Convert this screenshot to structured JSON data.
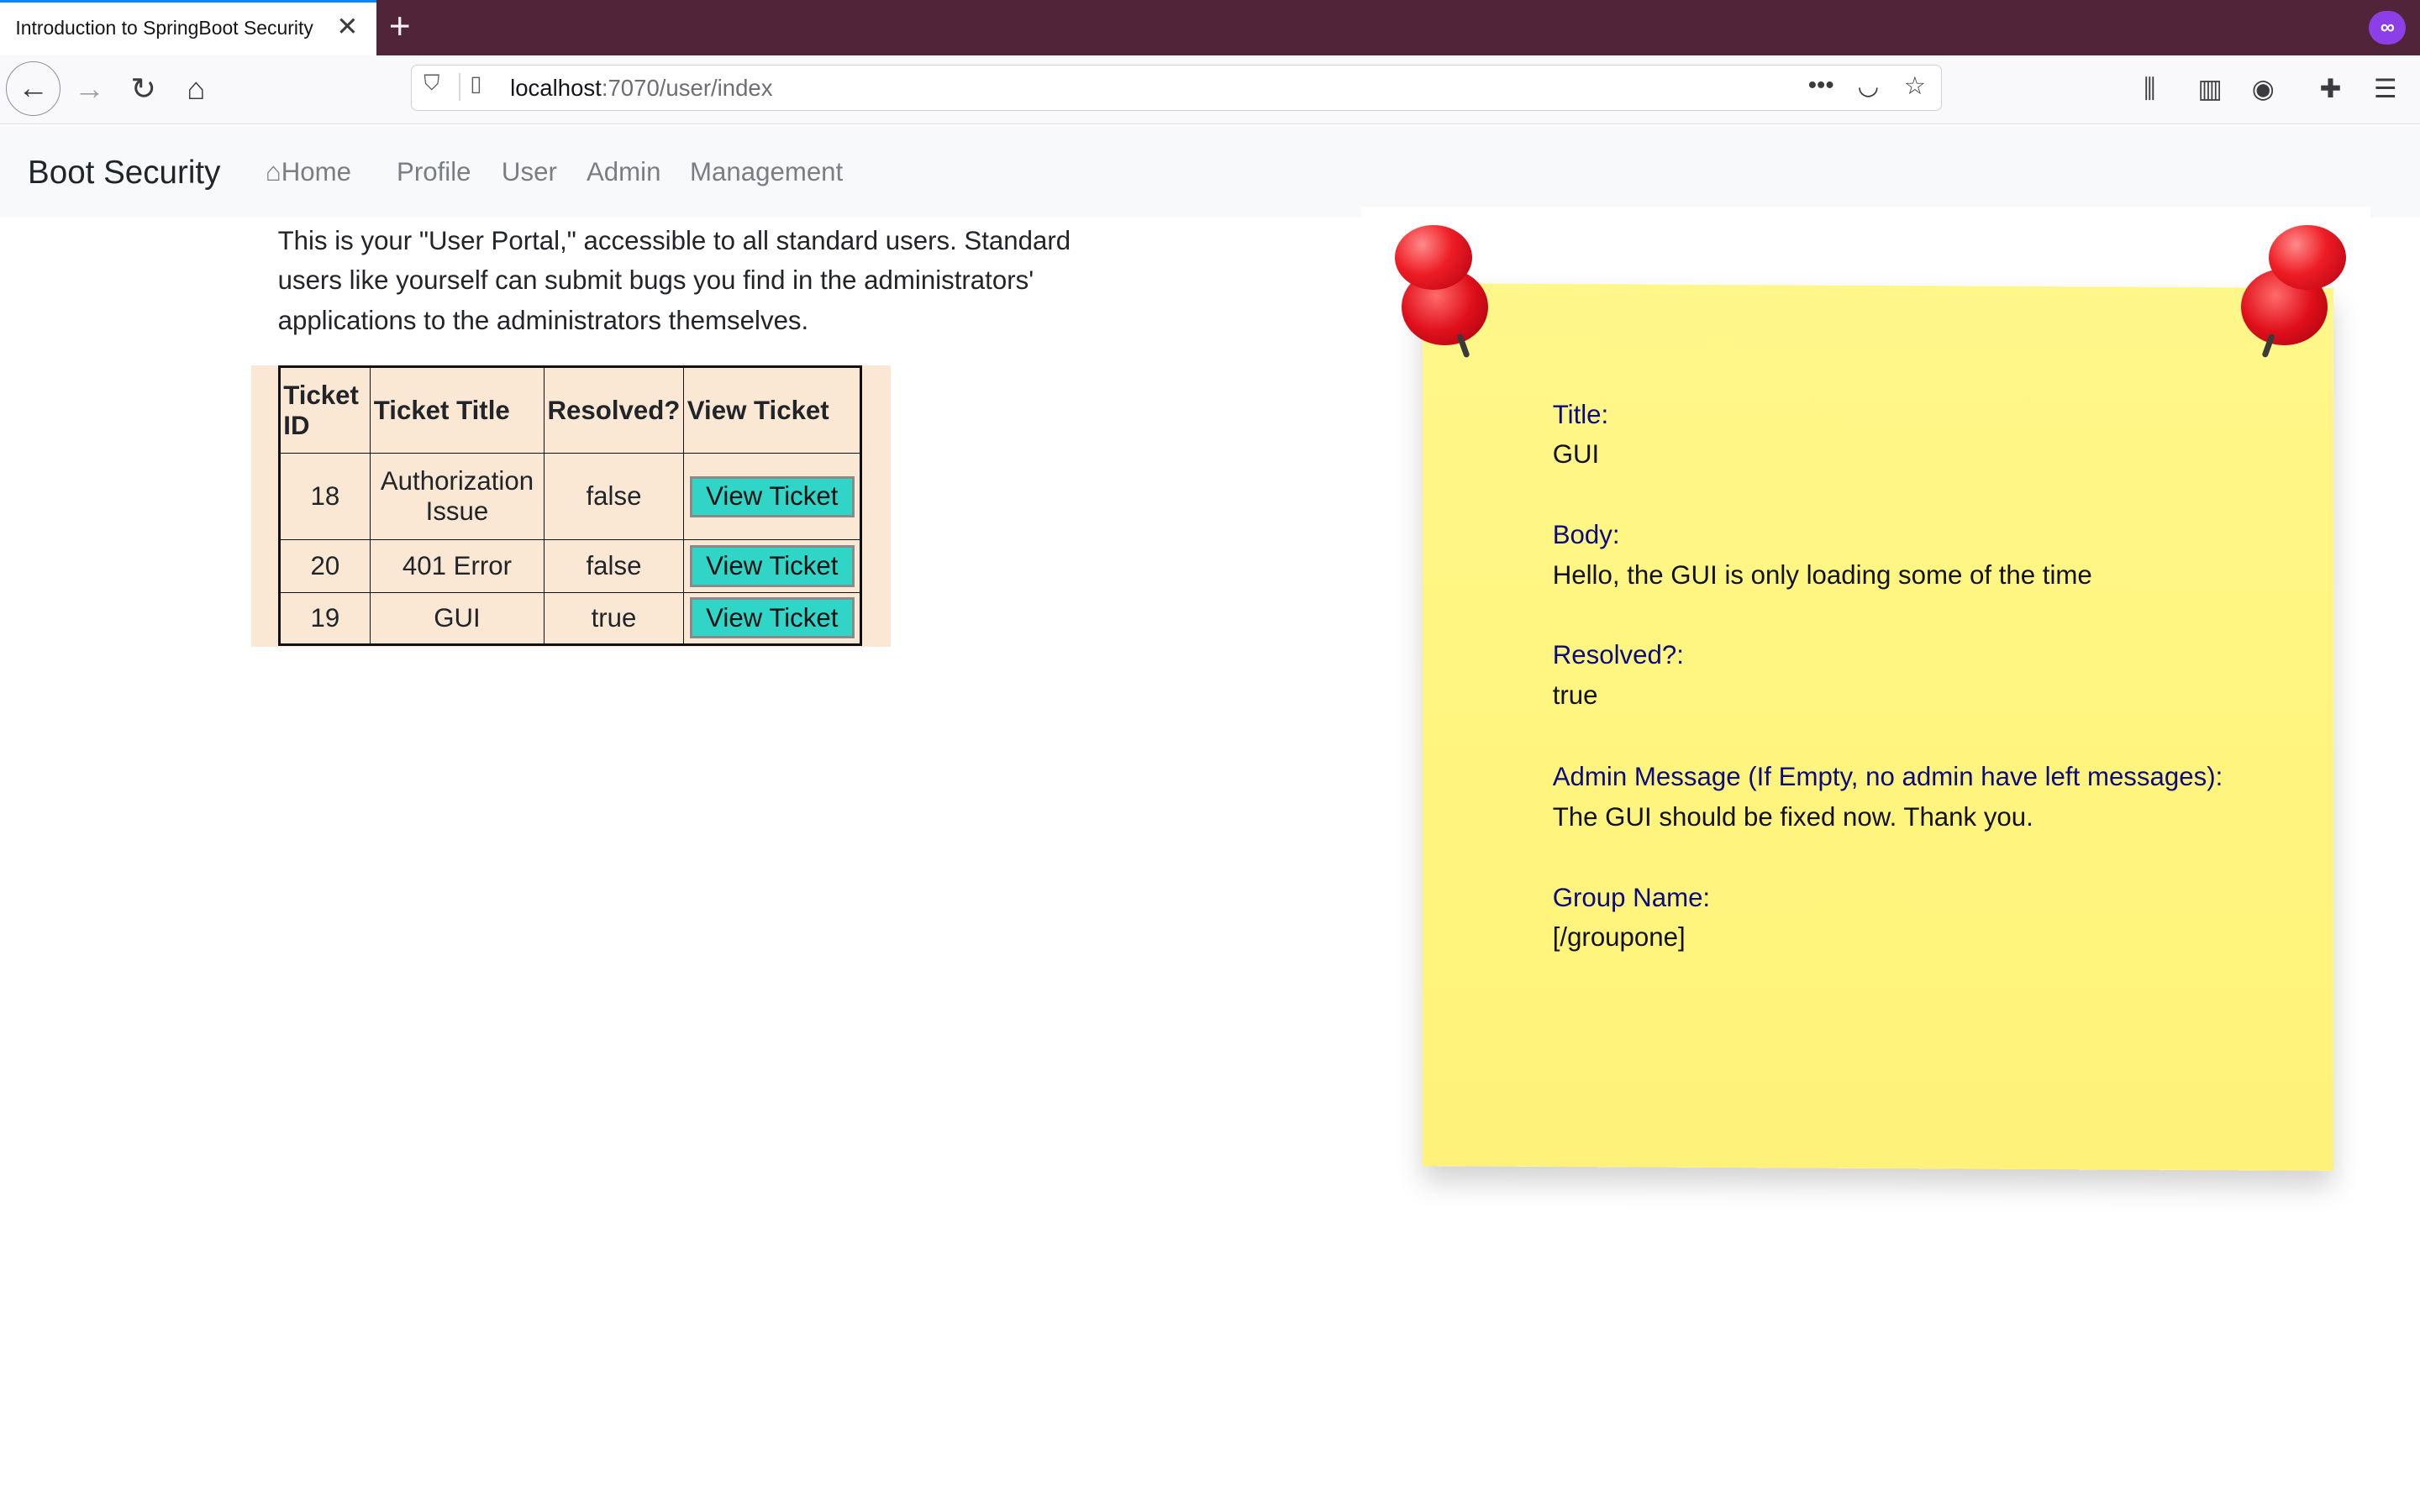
{
  "browser": {
    "tab_title": "Introduction to SpringBoot Security",
    "url_host": "localhost",
    "url_rest": ":7070/user/index"
  },
  "app": {
    "brand": "Boot Security",
    "nav": [
      "Home",
      "Profile",
      "User",
      "Admin",
      "Management"
    ]
  },
  "intro": "This is your \"User Portal,\" accessible to all standard users. Standard users like yourself can submit bugs you find in the administrators' applications to the administrators themselves.",
  "table": {
    "headers": [
      "Ticket ID",
      "Ticket Title",
      "Resolved?",
      "View Ticket"
    ],
    "rows": [
      {
        "id": "18",
        "title": "Authorization Issue",
        "resolved": "false",
        "action": "View Ticket"
      },
      {
        "id": "20",
        "title": "401 Error",
        "resolved": "false",
        "action": "View Ticket"
      },
      {
        "id": "19",
        "title": "GUI",
        "resolved": "true",
        "action": "View Ticket"
      }
    ]
  },
  "note": {
    "title_label": "Title:",
    "title_value": "GUI",
    "body_label": "Body:",
    "body_value": "Hello, the GUI is only loading some of the time",
    "resolved_label": "Resolved?:",
    "resolved_value": "true",
    "admin_label": "Admin Message (If Empty, no admin have left messages):",
    "admin_value": "The GUI should be fixed now. Thank you.",
    "group_label": "Group Name:",
    "group_value": "[/groupone]"
  },
  "colors": {
    "accent_button": "#30d5c8",
    "table_bg": "#fae8d4",
    "note_bg": "#fff57e",
    "note_label": "#0b0b80"
  }
}
